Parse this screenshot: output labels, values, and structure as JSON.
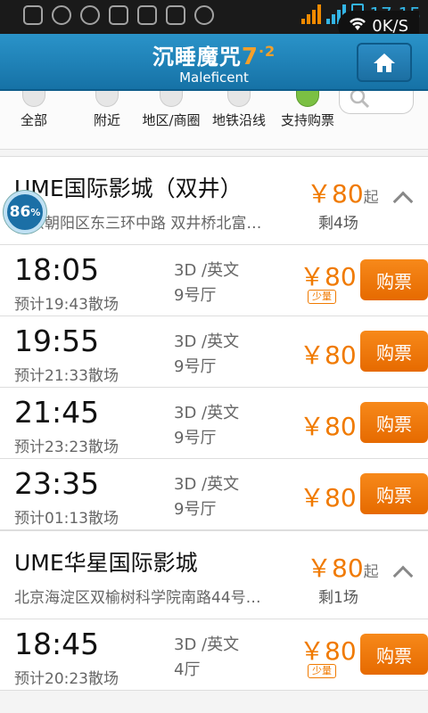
{
  "status_bar": {
    "time": "17:15",
    "net_speed": "0K/S",
    "left_icons": [
      "add-icon",
      "shield-icon",
      "100-icon",
      "usb-icon",
      "android-icon",
      "phone-icon",
      "alarm-icon"
    ],
    "right_icons": [
      "wifi-icon",
      "signal-orange-icon",
      "signal-blue-icon",
      "battery-icon"
    ]
  },
  "header": {
    "title": "沉睡魔咒",
    "rating_int": "7",
    "rating_dec": "·2",
    "subtitle": "Maleficent",
    "home_icon": "home-icon",
    "accent": "#f5a02a"
  },
  "filters": [
    {
      "label": "全部"
    },
    {
      "label": "附近"
    },
    {
      "label": "地区/商圈"
    },
    {
      "label": "地铁沿线"
    },
    {
      "label": "支持购票"
    }
  ],
  "cinemas": [
    {
      "name": "UME国际影城（双井）",
      "address": "北京朝阳区东三环中路 双井桥北富…",
      "price": "￥80",
      "price_suffix": "起",
      "remaining": "剩4场",
      "showings": [
        {
          "time": "18:05",
          "end": "预计19:43散场",
          "format": "3D /英文",
          "hall": "9号厅",
          "price": "￥80",
          "badge": "少量",
          "buy": "购票"
        },
        {
          "time": "19:55",
          "end": "预计21:33散场",
          "format": "3D /英文",
          "hall": "9号厅",
          "price": "￥80",
          "buy": "购票"
        },
        {
          "time": "21:45",
          "end": "预计23:23散场",
          "format": "3D /英文",
          "hall": "9号厅",
          "price": "￥80",
          "buy": "购票"
        },
        {
          "time": "23:35",
          "end": "预计01:13散场",
          "format": "3D /英文",
          "hall": "9号厅",
          "price": "￥80",
          "buy": "购票"
        }
      ]
    },
    {
      "name": "UME华星国际影城",
      "address": "北京海淀区双榆树科学院南路44号…",
      "price": "￥80",
      "price_suffix": "起",
      "remaining": "剩1场",
      "showings": [
        {
          "time": "18:45",
          "end": "预计20:23散场",
          "format": "3D /英文",
          "hall": "4厅",
          "price": "￥80",
          "badge": "少量",
          "buy": "购票"
        }
      ]
    }
  ],
  "progress_overlay": {
    "value": "86",
    "unit": "%"
  }
}
